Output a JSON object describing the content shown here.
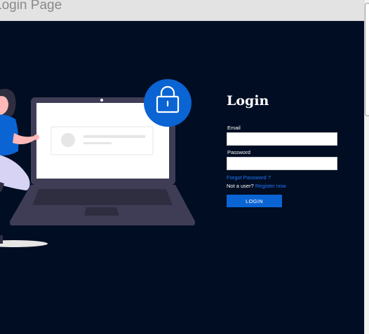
{
  "window": {
    "title": "Login Page"
  },
  "form": {
    "heading": "Login",
    "email_label": "Email",
    "email_value": "",
    "password_label": "Password",
    "password_value": "",
    "forgot_link": "Forgot Password ?",
    "not_user_text": "Not a user?",
    "register_link": "Register now",
    "login_button": "LOGIN"
  },
  "colors": {
    "page_background": "#000d22",
    "accent": "#0b64d3",
    "link": "#1e78ff",
    "titlebar": "#e3e3e3"
  },
  "icons": {
    "lock": "lock-icon",
    "laptop": "laptop-illustration",
    "person": "person-illustration"
  }
}
